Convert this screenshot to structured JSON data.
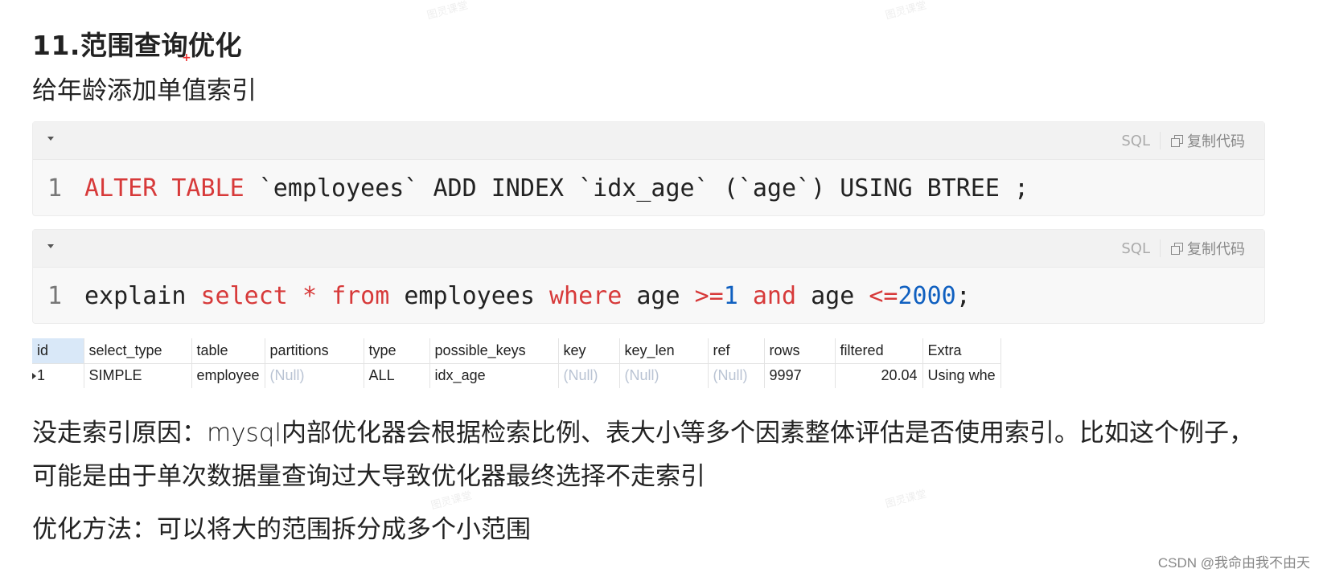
{
  "heading": "11.范围查询优化",
  "intro": "给年龄添加单值索引",
  "code_blocks": [
    {
      "language": "SQL",
      "copy_label": "复制代码",
      "line_number": "1",
      "tokens": [
        {
          "text": "ALTER TABLE",
          "kind": "kw"
        },
        {
          "text": " `employees` ADD INDEX `idx_age` (`age`) USING BTREE ;",
          "kind": "plain"
        }
      ]
    },
    {
      "language": "SQL",
      "copy_label": "复制代码",
      "line_number": "1",
      "tokens": [
        {
          "text": "explain ",
          "kind": "plain"
        },
        {
          "text": "select",
          "kind": "kw"
        },
        {
          "text": " ",
          "kind": "plain"
        },
        {
          "text": "*",
          "kind": "kw"
        },
        {
          "text": " ",
          "kind": "plain"
        },
        {
          "text": "from",
          "kind": "kw"
        },
        {
          "text": " employees ",
          "kind": "plain"
        },
        {
          "text": "where",
          "kind": "kw"
        },
        {
          "text": " age ",
          "kind": "plain"
        },
        {
          "text": ">=",
          "kind": "kw"
        },
        {
          "text": "1",
          "kind": "num"
        },
        {
          "text": " ",
          "kind": "plain"
        },
        {
          "text": "and",
          "kind": "kw"
        },
        {
          "text": " age ",
          "kind": "plain"
        },
        {
          "text": "<=",
          "kind": "kw"
        },
        {
          "text": "2000",
          "kind": "num"
        },
        {
          "text": ";",
          "kind": "plain"
        }
      ]
    }
  ],
  "explain_result": {
    "columns": [
      "id",
      "select_type",
      "table",
      "partitions",
      "type",
      "possible_keys",
      "key",
      "key_len",
      "ref",
      "rows",
      "filtered",
      "Extra"
    ],
    "rows": [
      [
        "1",
        "SIMPLE",
        "employee",
        "(Null)",
        "ALL",
        "idx_age",
        "(Null)",
        "(Null)",
        "(Null)",
        "9997",
        "20.04",
        "Using whe"
      ]
    ]
  },
  "reason_text": "没走索引原因：mysql内部优化器会根据检索比例、表大小等多个因素整体评估是否使用索引。比如这个例子，可能是由于单次数据量查询过大导致优化器最终选择不走索引",
  "method_text": "优化方法：可以将大的范围拆分成多个小范围",
  "watermark_text": "图灵课堂",
  "footer_credit": "CSDN @我命由我不由天"
}
